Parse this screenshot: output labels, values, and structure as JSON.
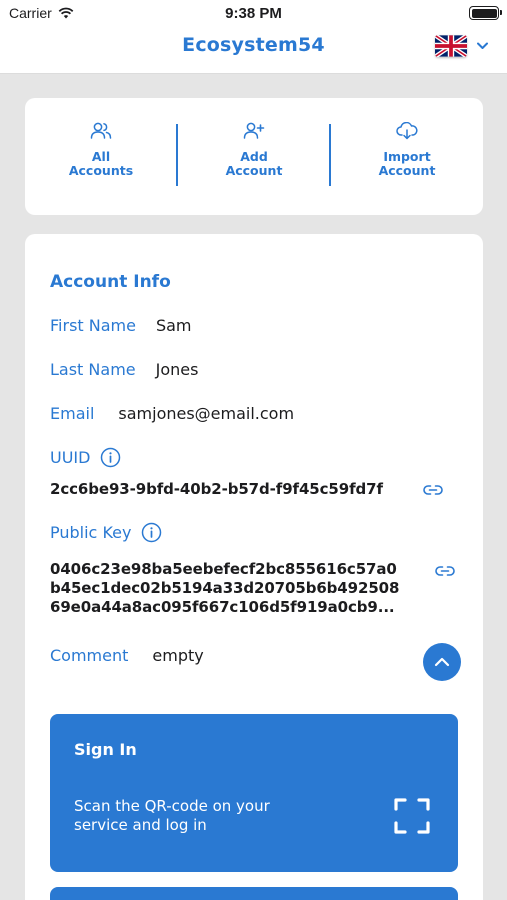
{
  "status_bar": {
    "carrier": "Carrier",
    "time": "9:38 PM"
  },
  "header": {
    "title": "Ecosystem54",
    "language_icon": "uk-flag-icon"
  },
  "actions": [
    {
      "line1": "All",
      "line2": "Accounts",
      "icon": "users-icon"
    },
    {
      "line1": "Add",
      "line2": "Account",
      "icon": "user-plus-icon"
    },
    {
      "line1": "Import",
      "line2": "Account",
      "icon": "cloud-download-icon"
    }
  ],
  "account": {
    "section_title": "Account Info",
    "first_name_label": "First Name",
    "first_name": "Sam",
    "last_name_label": "Last Name",
    "last_name": "Jones",
    "email_label": "Email",
    "email": "samjones@email.com",
    "uuid_label": "UUID",
    "uuid": "2cc6be93-9bfd-40b2-b57d-f9f45c59fd7f",
    "public_key_label": "Public Key",
    "public_key_lines": [
      "0406c23e98ba5eebefecf2bc855616c57a0",
      "b45ec1dec02b5194a33d20705b6b492508",
      "69e0a44a8ac095f667c106d5f919a0cb9..."
    ],
    "comment_label": "Comment",
    "comment": "empty"
  },
  "signin": {
    "title": "Sign In",
    "line1": "Scan the QR-code on your",
    "line2": "service and log in"
  },
  "colors": {
    "accent": "#2a79d2",
    "background": "#e5e5e5"
  }
}
